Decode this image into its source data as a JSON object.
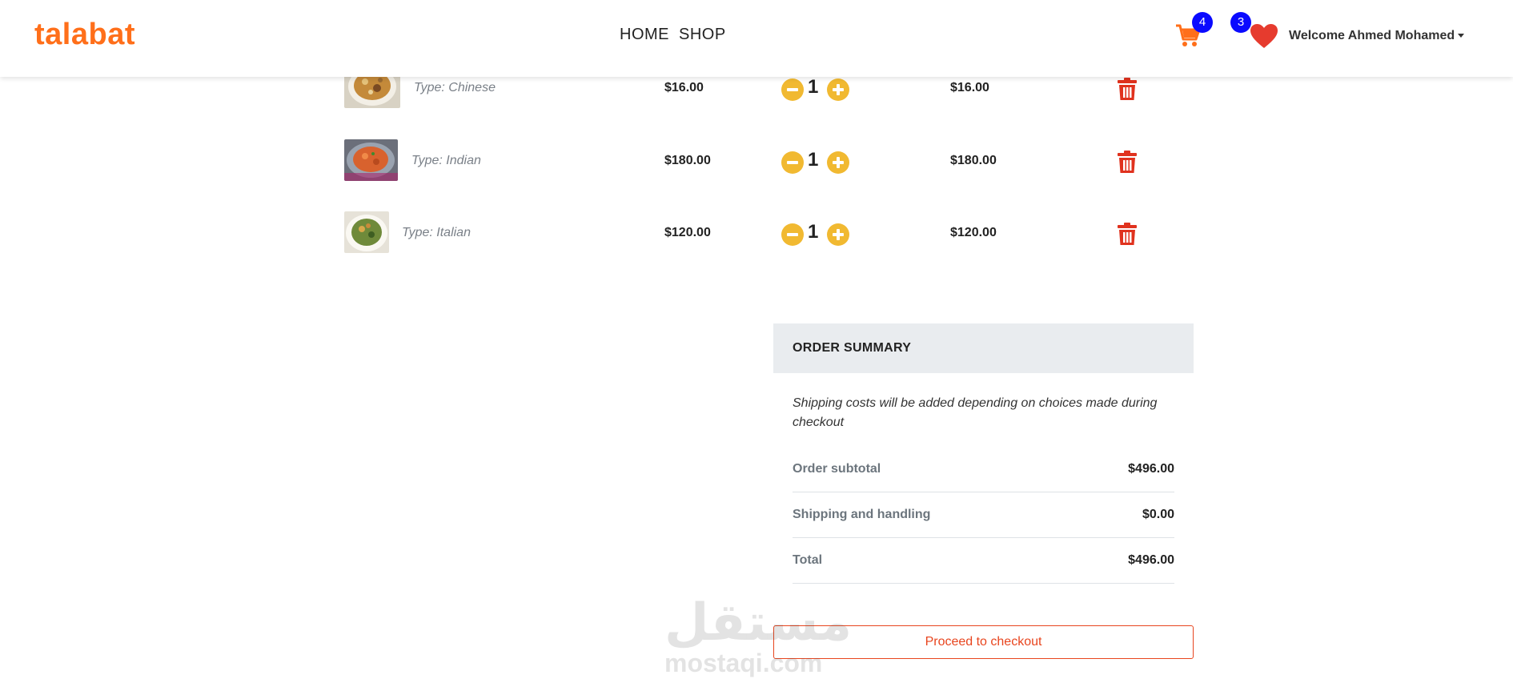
{
  "header": {
    "brand": "talabat",
    "nav": [
      "HOME",
      "SHOP"
    ],
    "cart_count": "4",
    "favorites_count": "3",
    "welcome": "Welcome Ahmed Mohamed",
    "brand_color": "#ff6f1a",
    "icons": [
      "cart-icon",
      "heart-icon",
      "chevron-down-icon"
    ]
  },
  "cart": {
    "items": [
      {
        "type": "Type: Chinese",
        "price": "$16.00",
        "quantity": "1",
        "total": "$16.00"
      },
      {
        "type": "Type: Indian",
        "price": "$180.00",
        "quantity": "1",
        "total": "$180.00"
      },
      {
        "type": "Type: Italian",
        "price": "$120.00",
        "quantity": "1",
        "total": "$120.00"
      }
    ],
    "accent_color": "#f1b931",
    "delete_color": "#e0321e"
  },
  "summary": {
    "title": "ORDER SUMMARY",
    "note": "Shipping costs will be added depending on choices made during checkout",
    "rows": [
      {
        "label": "Order subtotal",
        "value": "$496.00"
      },
      {
        "label": "Shipping and handling",
        "value": "$0.00"
      },
      {
        "label": "Total",
        "value": "$496.00"
      }
    ],
    "checkout_label": "Proceed to checkout",
    "checkout_color": "#e8451e"
  },
  "watermark": {
    "arabic": "مستقل",
    "latin": "mostaqi.com"
  }
}
